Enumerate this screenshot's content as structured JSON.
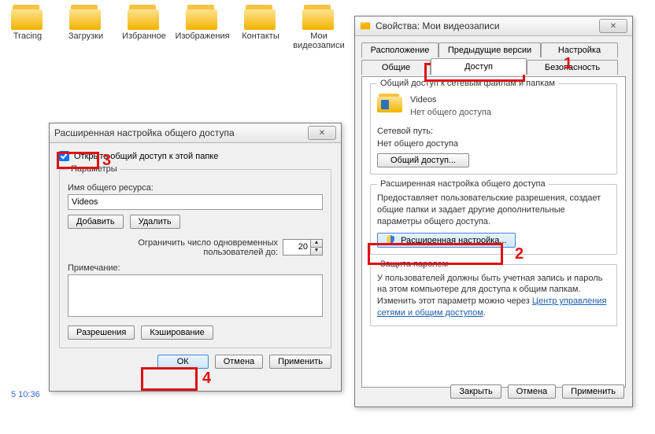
{
  "explorer": {
    "folders": [
      "Tracing",
      "Загрузки",
      "Избранное",
      "Изображения",
      "Контакты",
      "Мои видеозаписи"
    ],
    "timestamp": "5 10:36"
  },
  "props": {
    "title": "Свойства: Мои видеозаписи",
    "tabs": {
      "location": "Расположение",
      "prev": "Предыдущие версии",
      "settings": "Настройка",
      "general": "Общие",
      "sharing": "Доступ",
      "security": "Безопасность"
    },
    "share_group": "Общий доступ к сетевым файлам и папкам",
    "videos_name": "Videos",
    "no_share": "Нет общего доступа",
    "netpath_label": "Сетевой путь:",
    "netpath_value": "Нет общего доступа",
    "share_btn": "Общий доступ...",
    "adv_group": "Расширенная настройка общего доступа",
    "adv_desc": "Предоставляет пользовательские разрешения, создает общие папки и задает другие дополнительные параметры общего доступа.",
    "adv_btn": "Расширенная настройка...",
    "pw_group": "Защита паролем",
    "pw_desc": "У пользователей должны быть учетная запись и пароль на этом компьютере для доступа к общим папкам. Изменить этот параметр можно через ",
    "pw_link": "Центр управления сетями и общим доступом",
    "close": "Закрыть",
    "cancel": "Отмена",
    "apply": "Применить"
  },
  "adv": {
    "title": "Расширенная настройка общего доступа",
    "open_share": "Открыть общий доступ к этой папке",
    "params": "Параметры",
    "share_name_label": "Имя общего ресурса:",
    "share_name_value": "Videos",
    "add": "Добавить",
    "remove": "Удалить",
    "limit_label": "Ограничить число одновременных пользователей до:",
    "limit_value": "20",
    "comment_label": "Примечание:",
    "permissions": "Разрешения",
    "caching": "Кэширование",
    "ok": "ОК",
    "cancel": "Отмена",
    "apply": "Применить"
  },
  "anno": {
    "n1": "1",
    "n2": "2",
    "n3": "3",
    "n4": "4"
  }
}
